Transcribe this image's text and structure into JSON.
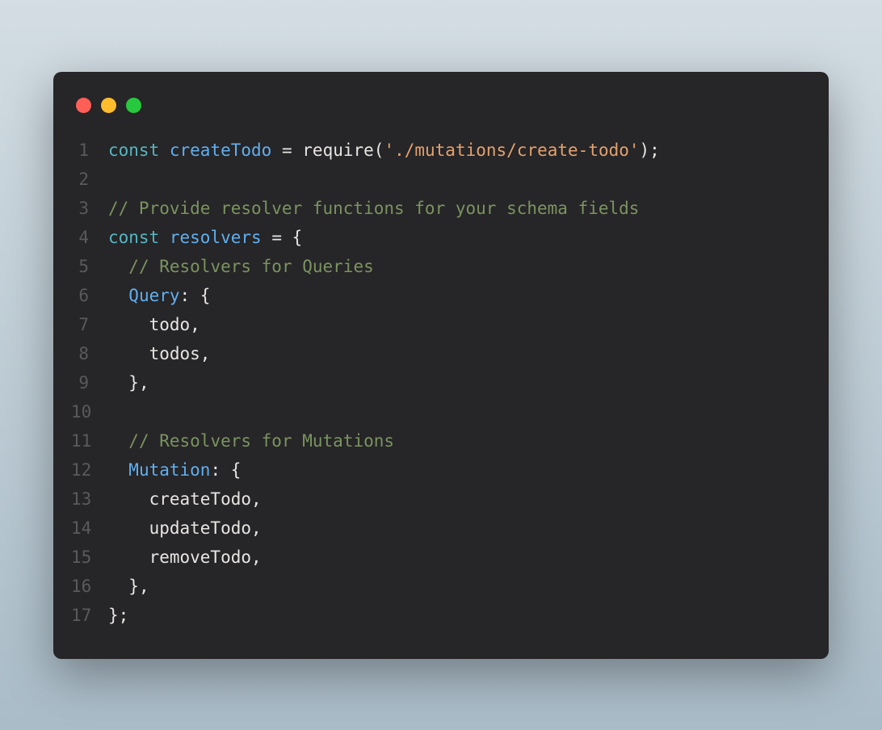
{
  "window": {
    "traffic_lights": {
      "red": "#ff5f56",
      "yellow": "#ffbd2e",
      "green": "#27c93f"
    }
  },
  "colors": {
    "background": "#262527",
    "keyword": "#56b6c2",
    "identifier_blue": "#61afef",
    "string": "#e2a26f",
    "comment": "#7a9460",
    "default": "#e8e6e3",
    "line_number": "#5a595d"
  },
  "code": {
    "lines": [
      {
        "num": "1",
        "tokens": [
          {
            "cls": "tk-keyword",
            "text": "const"
          },
          {
            "cls": "",
            "text": " "
          },
          {
            "cls": "tk-const-name",
            "text": "createTodo"
          },
          {
            "cls": "",
            "text": " "
          },
          {
            "cls": "tk-operator",
            "text": "="
          },
          {
            "cls": "",
            "text": " "
          },
          {
            "cls": "tk-function",
            "text": "require"
          },
          {
            "cls": "tk-punct",
            "text": "("
          },
          {
            "cls": "tk-string",
            "text": "'./mutations/create-todo'"
          },
          {
            "cls": "tk-punct",
            "text": ");"
          }
        ]
      },
      {
        "num": "2",
        "tokens": []
      },
      {
        "num": "3",
        "tokens": [
          {
            "cls": "tk-comment",
            "text": "// Provide resolver functions for your schema fields"
          }
        ]
      },
      {
        "num": "4",
        "tokens": [
          {
            "cls": "tk-keyword",
            "text": "const"
          },
          {
            "cls": "",
            "text": " "
          },
          {
            "cls": "tk-const-name",
            "text": "resolvers"
          },
          {
            "cls": "",
            "text": " "
          },
          {
            "cls": "tk-operator",
            "text": "="
          },
          {
            "cls": "",
            "text": " "
          },
          {
            "cls": "tk-punct",
            "text": "{"
          }
        ]
      },
      {
        "num": "5",
        "tokens": [
          {
            "cls": "",
            "text": "  "
          },
          {
            "cls": "tk-comment",
            "text": "// Resolvers for Queries"
          }
        ]
      },
      {
        "num": "6",
        "tokens": [
          {
            "cls": "",
            "text": "  "
          },
          {
            "cls": "tk-property",
            "text": "Query"
          },
          {
            "cls": "tk-punct",
            "text": ": {"
          }
        ]
      },
      {
        "num": "7",
        "tokens": [
          {
            "cls": "",
            "text": "    "
          },
          {
            "cls": "tk-ident",
            "text": "todo"
          },
          {
            "cls": "tk-punct",
            "text": ","
          }
        ]
      },
      {
        "num": "8",
        "tokens": [
          {
            "cls": "",
            "text": "    "
          },
          {
            "cls": "tk-ident",
            "text": "todos"
          },
          {
            "cls": "tk-punct",
            "text": ","
          }
        ]
      },
      {
        "num": "9",
        "tokens": [
          {
            "cls": "",
            "text": "  "
          },
          {
            "cls": "tk-punct",
            "text": "},"
          }
        ]
      },
      {
        "num": "10",
        "tokens": []
      },
      {
        "num": "11",
        "tokens": [
          {
            "cls": "",
            "text": "  "
          },
          {
            "cls": "tk-comment",
            "text": "// Resolvers for Mutations"
          }
        ]
      },
      {
        "num": "12",
        "tokens": [
          {
            "cls": "",
            "text": "  "
          },
          {
            "cls": "tk-property",
            "text": "Mutation"
          },
          {
            "cls": "tk-punct",
            "text": ": {"
          }
        ]
      },
      {
        "num": "13",
        "tokens": [
          {
            "cls": "",
            "text": "    "
          },
          {
            "cls": "tk-ident",
            "text": "createTodo"
          },
          {
            "cls": "tk-punct",
            "text": ","
          }
        ]
      },
      {
        "num": "14",
        "tokens": [
          {
            "cls": "",
            "text": "    "
          },
          {
            "cls": "tk-ident",
            "text": "updateTodo"
          },
          {
            "cls": "tk-punct",
            "text": ","
          }
        ]
      },
      {
        "num": "15",
        "tokens": [
          {
            "cls": "",
            "text": "    "
          },
          {
            "cls": "tk-ident",
            "text": "removeTodo"
          },
          {
            "cls": "tk-punct",
            "text": ","
          }
        ]
      },
      {
        "num": "16",
        "tokens": [
          {
            "cls": "",
            "text": "  "
          },
          {
            "cls": "tk-punct",
            "text": "},"
          }
        ]
      },
      {
        "num": "17",
        "tokens": [
          {
            "cls": "tk-punct",
            "text": "};"
          }
        ]
      }
    ]
  }
}
